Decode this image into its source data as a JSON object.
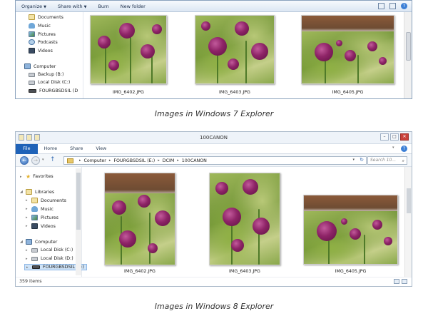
{
  "win7": {
    "toolbar": {
      "organize": "Organize",
      "share_with": "Share with",
      "burn": "Burn",
      "new_folder": "New folder"
    },
    "nav": {
      "documents": "Documents",
      "music": "Music",
      "pictures": "Pictures",
      "podcasts": "Podcasts",
      "videos": "Videos",
      "computer": "Computer",
      "backup": "Backup (B:)",
      "local_disk": "Local Disk (C:)",
      "usb": "FOURGBSDSIL (D"
    },
    "files": [
      "IMG_6402.JPG",
      "IMG_6403.JPG",
      "IMG_6405.JPG"
    ]
  },
  "caption1": "Images in Windows 7 Explorer",
  "win8": {
    "title": "100CANON",
    "ribbon": {
      "file": "File",
      "home": "Home",
      "share": "Share",
      "view": "View"
    },
    "breadcrumb": [
      "Computer",
      "FOURGBSDSIL (E:)",
      "DCIM",
      "100CANON"
    ],
    "search_placeholder": "Search 10...",
    "nav": {
      "favorites": "Favorites",
      "libraries": "Libraries",
      "documents": "Documents",
      "music": "Music",
      "pictures": "Pictures",
      "videos": "Videos",
      "computer": "Computer",
      "local_c": "Local Disk (C:)",
      "local_d": "Local Disk (D:)",
      "usb": "FOURGBSDSIL (E:)"
    },
    "files": [
      "IMG_6402.JPG",
      "IMG_6403.JPG",
      "IMG_6405.JPG"
    ],
    "status": "359 items"
  },
  "caption2": "Images in Windows 8 Explorer"
}
